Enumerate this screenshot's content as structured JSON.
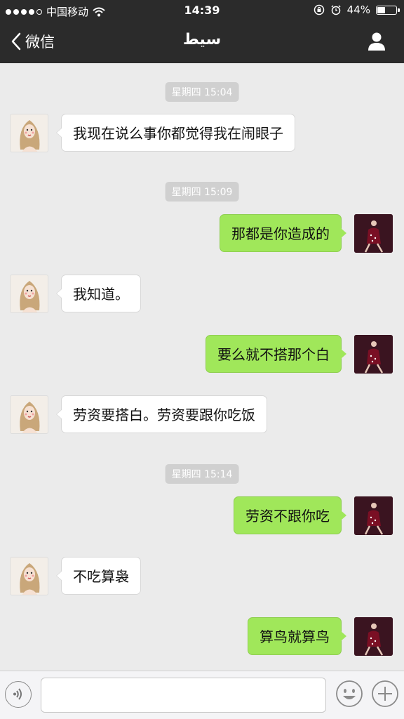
{
  "status_bar": {
    "carrier": "中国移动",
    "time": "14:39",
    "battery_text": "44%",
    "battery_level": 0.44
  },
  "nav": {
    "back_label": "微信",
    "title": "سيط"
  },
  "messages": {
    "t1": "星期四 15:04",
    "m1": "我现在说么事你都觉得我在闹眼子",
    "t2": "星期四 15:09",
    "m2": "那都是你造成的",
    "m3": "我知道。",
    "m4": "要么就不搭那个白",
    "m5": "劳资要搭白。劳资要跟你吃饭",
    "t3": "星期四 15:14",
    "m6": "劳资不跟你吃",
    "m7": "不吃算袅",
    "m8": "算鸟就算鸟"
  },
  "input": {
    "placeholder": ""
  },
  "colors": {
    "nav_bg": "#2b2b2b",
    "chat_bg": "#ebebeb",
    "outgoing_bubble": "#a0e75a",
    "incoming_bubble": "#ffffff",
    "timestamp_bg": "#d0d0d0"
  },
  "icons": {
    "back": "chevron-left-icon",
    "profile": "person-icon",
    "voice": "voice-icon",
    "emoji": "smiley-icon",
    "plus": "plus-icon",
    "wifi": "wifi-icon",
    "lock": "orientation-lock-icon",
    "alarm": "alarm-icon"
  }
}
